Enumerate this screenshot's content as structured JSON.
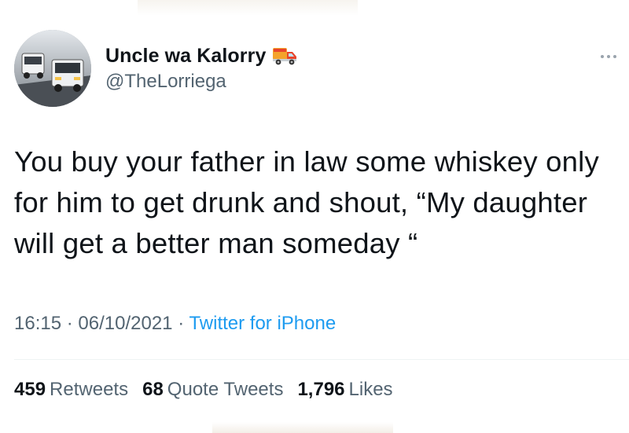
{
  "user": {
    "display_name": "Uncle wa Kalorry",
    "handle": "@TheLorriega",
    "avatar_icon": "truck-avatar",
    "name_emoji": "delivery-truck-icon"
  },
  "tweet": {
    "text": "You buy your father in law some whiskey only for him to get drunk and shout, “My daughter will get a better man someday “"
  },
  "meta": {
    "time": "16:15",
    "date": "06/10/2021",
    "separator": "·",
    "source": "Twitter for iPhone"
  },
  "stats": {
    "retweets_count": "459",
    "retweets_label": "Retweets",
    "quotes_count": "68",
    "quotes_label": "Quote Tweets",
    "likes_count": "1,796",
    "likes_label": "Likes"
  },
  "colors": {
    "text_primary": "#0f1419",
    "text_secondary": "#536471",
    "link": "#1d9bf0",
    "divider": "#eff3f4"
  }
}
